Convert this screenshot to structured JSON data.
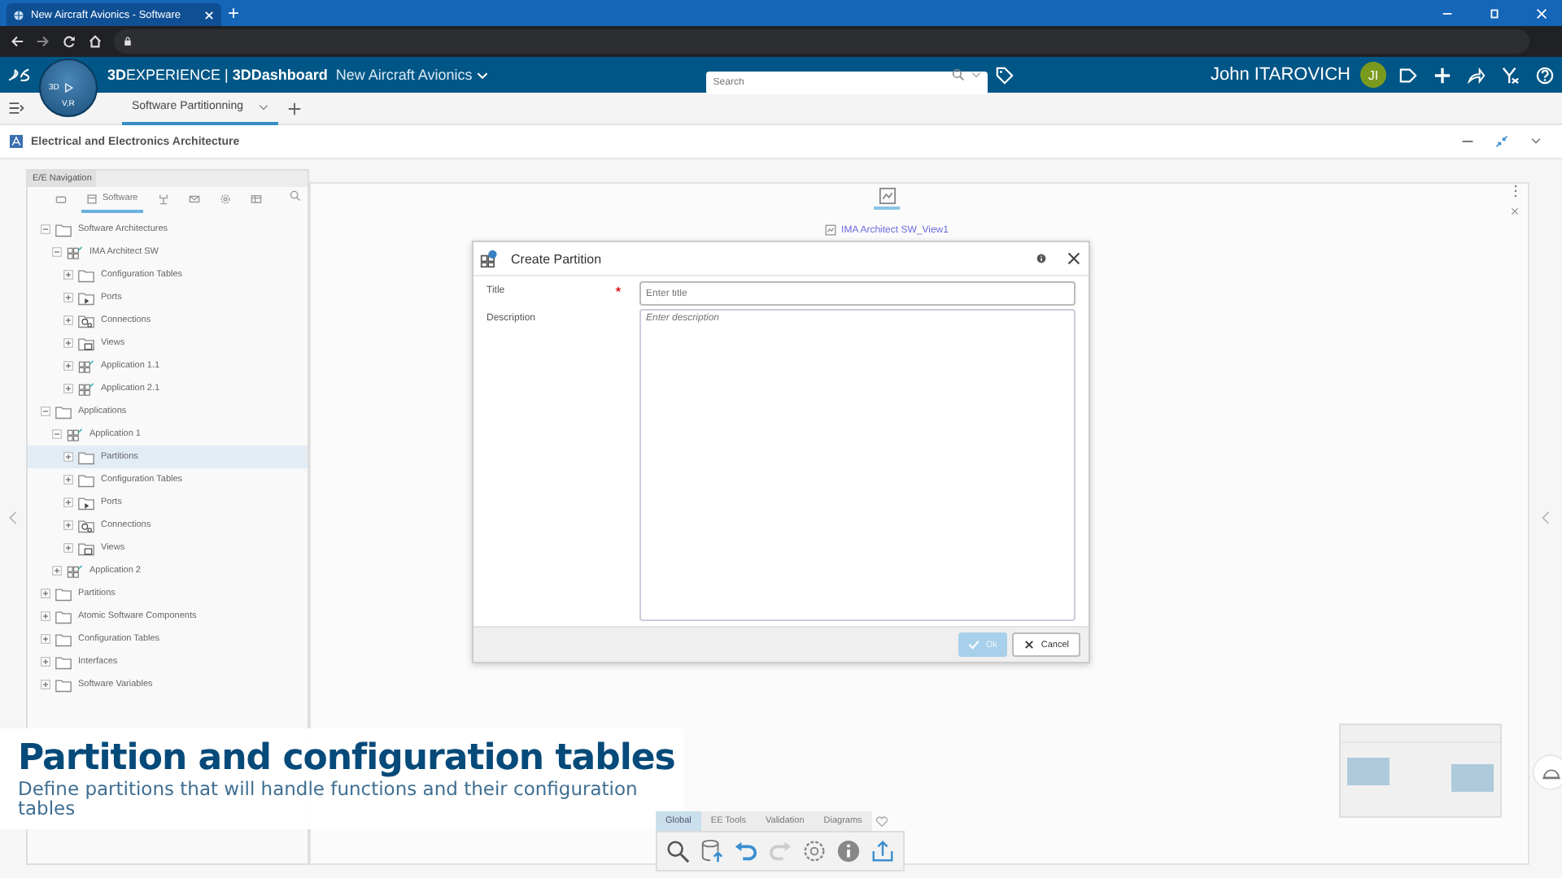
{
  "browser": {
    "tab_title": "New Aircraft Avionics - Software",
    "new_tab": "+"
  },
  "topbar": {
    "brand": "**3D**EXPERIENCE | **3DDashboard**",
    "dashboard": "New Aircraft Avionics",
    "search": {
      "placeholder": "Search"
    },
    "user": "John ITAROVICH",
    "avatar": "JI",
    "compass": [
      "3D",
      "V,R"
    ]
  },
  "tabs": [
    {
      "label": "Software Partitionning",
      "selected": true
    }
  ],
  "widget": {
    "title": "Electrical and Electronics Architecture"
  },
  "nav": {
    "title": "E/E Navigation",
    "tabs": [
      {
        "kind": "camera",
        "selected": false
      },
      {
        "kind": "software",
        "label": "Software",
        "selected": true
      },
      {
        "kind": "network",
        "selected": false
      },
      {
        "kind": "mail",
        "selected": false
      },
      {
        "kind": "gear",
        "selected": false
      },
      {
        "kind": "table",
        "selected": false
      }
    ]
  },
  "tree": [
    {
      "label": "Software Architectures",
      "kind": "folder",
      "expanded": true,
      "selected": false,
      "children": [
        {
          "label": "IMA Architect SW",
          "kind": "component",
          "expanded": true,
          "selected": false,
          "children": [
            {
              "label": "Configuration Tables",
              "kind": "folder",
              "expanded": false,
              "selected": false
            },
            {
              "label": "Ports",
              "kind": "ports",
              "expanded": false,
              "selected": false
            },
            {
              "label": "Connections",
              "kind": "connections",
              "expanded": false,
              "selected": false
            },
            {
              "label": "Views",
              "kind": "views",
              "expanded": false,
              "selected": false
            },
            {
              "label": "Application 1.1",
              "kind": "component",
              "expanded": false,
              "selected": false
            },
            {
              "label": "Application 2.1",
              "kind": "component",
              "expanded": false,
              "selected": false
            }
          ]
        }
      ]
    },
    {
      "label": "Applications",
      "kind": "folder",
      "expanded": true,
      "selected": false,
      "children": [
        {
          "label": "Application 1",
          "kind": "component",
          "expanded": true,
          "selected": false,
          "children": [
            {
              "label": "Partitions",
              "kind": "folder",
              "expanded": false,
              "selected": true
            },
            {
              "label": "Configuration Tables",
              "kind": "folder",
              "expanded": false,
              "selected": false
            },
            {
              "label": "Ports",
              "kind": "ports",
              "expanded": false,
              "selected": false
            },
            {
              "label": "Connections",
              "kind": "connections",
              "expanded": false,
              "selected": false
            },
            {
              "label": "Views",
              "kind": "views",
              "expanded": false,
              "selected": false
            }
          ]
        },
        {
          "label": "Application 2",
          "kind": "component",
          "expanded": false,
          "selected": false
        }
      ]
    },
    {
      "label": "Partitions",
      "kind": "folder",
      "expanded": false,
      "selected": false
    },
    {
      "label": "Atomic Software Components",
      "kind": "folder",
      "expanded": false,
      "selected": false
    },
    {
      "label": "Configuration Tables",
      "kind": "folder",
      "expanded": false,
      "selected": false
    },
    {
      "label": "Interfaces",
      "kind": "folder",
      "expanded": false,
      "selected": false
    },
    {
      "label": "Software Variables",
      "kind": "folder",
      "expanded": false,
      "selected": false
    }
  ],
  "canvas": {
    "view": "IMA Architect SW_View1"
  },
  "dialog": {
    "title": "Create Partition",
    "fields": [
      {
        "label": "Title",
        "required": true,
        "kind": "input",
        "placeholder": "Enter title"
      },
      {
        "label": "Description",
        "required": false,
        "kind": "textarea",
        "placeholder": "Enter description"
      }
    ],
    "buttons": [
      {
        "label": "Ok",
        "kind": "ok",
        "disabled": true
      },
      {
        "label": "Cancel",
        "kind": "cancel",
        "disabled": false
      }
    ]
  },
  "caption": {
    "title": "Partition and configuration tables",
    "subtitle": "Define partitions that will handle functions and their configuration tables"
  },
  "toolbar": {
    "tabs": [
      {
        "label": "Global",
        "selected": true
      },
      {
        "label": "EE Tools",
        "selected": false
      },
      {
        "label": "Validation",
        "selected": false
      },
      {
        "label": "Diagrams",
        "selected": false
      }
    ],
    "tools": [
      {
        "kind": "search"
      },
      {
        "kind": "database"
      },
      {
        "kind": "undo",
        "disabled": false
      },
      {
        "kind": "redo",
        "disabled": true
      },
      {
        "kind": "settings"
      },
      {
        "kind": "info"
      },
      {
        "kind": "export"
      }
    ]
  }
}
